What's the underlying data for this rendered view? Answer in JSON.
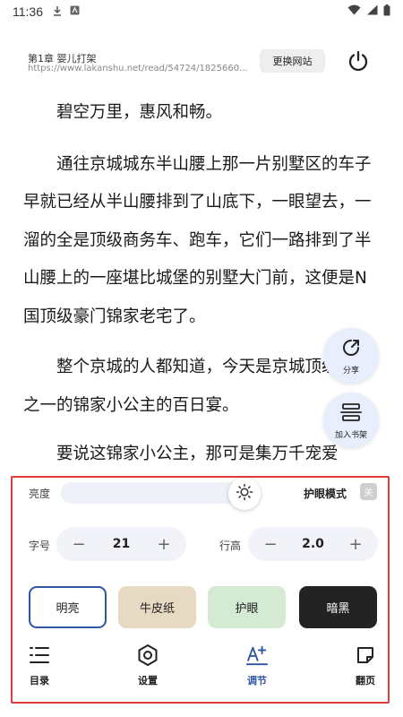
{
  "status_bar": {
    "time": "11:36",
    "icons": [
      "download-icon",
      "notification-icon",
      "wifi-icon",
      "signal-icon",
      "battery-icon"
    ]
  },
  "header": {
    "chapter_title": "第1章 婴儿打架",
    "url": "https://www.lakanshu.net/read/54724/1825660...",
    "switch_site_label": "更换网站",
    "power_icon": "power-icon"
  },
  "content": {
    "paragraphs": [
      "碧空万里，惠风和畅。",
      "通往京城城东半山腰上那一片别墅区的车子早就已经从半山腰排到了山底下，一眼望去，一溜的全是顶级商务车、跑车，它们一路排到了半山腰上的一座堪比城堡的别墅大门前，这便是N国顶级豪门锦家老宅了。",
      "整个京城的人都知道，今天是京城顶级豪门之一的锦家小公主的百日宴。",
      "要说这锦家小公主，那可是集万千宠爱"
    ]
  },
  "floating": {
    "share_label": "分享",
    "add_shelf_label": "加入书架"
  },
  "panel": {
    "brightness_label": "亮度",
    "brightness_level": 0.95,
    "eye_mode_label": "护眼模式",
    "eye_mode_state": "关",
    "font_size_label": "字号",
    "font_size_value": "21",
    "line_height_label": "行高",
    "line_height_value": "2.0",
    "minus_symbol": "−",
    "plus_symbol": "+",
    "themes": [
      {
        "label": "明亮",
        "color": "#ffffff",
        "selected": true
      },
      {
        "label": "牛皮纸",
        "color": "#e7dac2",
        "selected": false
      },
      {
        "label": "护眼",
        "color": "#d4ead2",
        "selected": false
      },
      {
        "label": "暗黑",
        "color": "#232323",
        "selected": false
      }
    ],
    "nav": [
      {
        "label": "目录",
        "icon": "list-icon",
        "active": false
      },
      {
        "label": "设置",
        "icon": "settings-icon",
        "active": false
      },
      {
        "label": "调节",
        "icon": "text-adjust-icon",
        "active": true
      },
      {
        "label": "翻页",
        "icon": "page-turn-icon",
        "active": false
      }
    ],
    "accent_color": "#2f55a4",
    "highlight_border_color": "#e23b3b"
  }
}
